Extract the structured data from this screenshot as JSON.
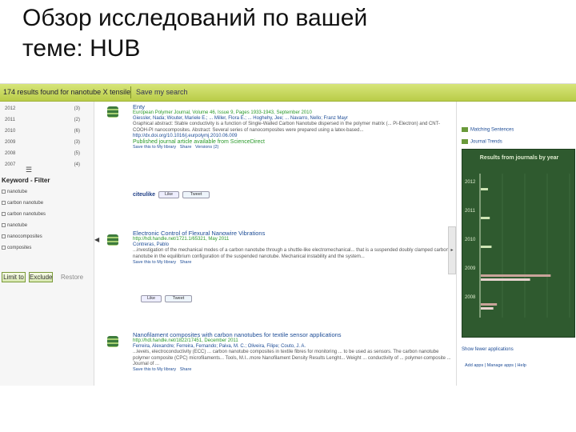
{
  "slide": {
    "title_line1": "Обзор исследований по вашей",
    "title_line2": "теме: HUB"
  },
  "topbar": {
    "query": "174 results found for nanotube X tensile",
    "save_link": "Save my search"
  },
  "filters": {
    "years": [
      {
        "year": "2012",
        "count": "(3)"
      },
      {
        "year": "2011",
        "count": "(2)"
      },
      {
        "year": "2010",
        "count": "(6)"
      },
      {
        "year": "2009",
        "count": "(3)"
      },
      {
        "year": "2008",
        "count": "(5)"
      },
      {
        "year": "2007",
        "count": "(4)"
      }
    ],
    "keyword_title": "Keyword - Filter",
    "keywords": [
      "nanotube",
      "carbon nanotube",
      "carbon nanotubes",
      "nanotube",
      "nanocomposites",
      "composites"
    ],
    "filter_button": "Limit to",
    "exclude_button": "Exclude",
    "restore_label": "Restore"
  },
  "results": [
    {
      "title": "Enty",
      "source": "European Polymer Journal, Volume 46, Issue 9, Pages 1933-1943, September 2010",
      "authors": "Giessler, Nada; Wouter, Mariele E.; ... Miller, Flora E.; ... Hoghehy, Jee; ... Navarro, Nello; Franz Mayr",
      "snippet": "Graphical abstract: Stable conductivity is a function of Single-Walled Carbon Nanotube dispersed in the polymer matrix (... Pi-Electron) and CNT-COOH-PI nanocomposites. Abstract: Several series of nanocomposites were prepared using a latex-based...",
      "doi": "http://dx.doi.org/10.1016/j.eurpolymj.2010.06.009",
      "published": "Published journal article available from ScienceDirect",
      "links": [
        "Save this to My library",
        "Share",
        "Versions (2)"
      ],
      "citeulike": "citeulike",
      "like": "Like",
      "tweet": "Tweet"
    },
    {
      "title": "Electronic Control of Flexural Nanowire Vibrations",
      "source": "http://hdl.handle.net/1721.1/65321, May 2011",
      "authors": "Contreras, Pablo",
      "snippet": "...investigation of the mechanical modes of a carbon nanotube through a shuttle-like electromechanical... that is a suspended doubly clamped carbon nanotube in the equilibrium configuration of the suspended nanotube. Mechanical instability and the system...",
      "links": [
        "Save this to My library",
        "Share"
      ],
      "like": "Like",
      "tweet": "Tweet"
    },
    {
      "title": "Nanofilament composites with carbon nanotubes for textile sensor applications",
      "source": "http://hdl.handle.net/1822/17451, December 2011",
      "authors": "Ferreira, Alexandre; Ferreira, Fernando; Paiva, M. C.; Oliveira, Filipe; Couto, J. A.",
      "snippet": "...levels, electroconductivity (ECC) ... carbon nanotube composites in textile fibres for monitoring ... to be used as sensors. The carbon nanotube polymer composite (CPC) microfilaments... Tools, M.I...more Nanofilament Density Results Lenght... Weight ... conductivity of ... polymer-composite ... Journal of ...",
      "links": [
        "Save this to My library",
        "Share"
      ]
    }
  ],
  "sidebar": {
    "matching_sentences": "Matching Sentences",
    "journal_trends": "Journal Trends",
    "panel_title": "Results from journals by year",
    "show_fewer": "Show fewer applications",
    "footer_links": "Add apps | Manage apps | Help"
  },
  "chart_data": {
    "type": "bar",
    "orientation": "horizontal",
    "title": "Results from journals by year",
    "categories": [
      "2012",
      "2011",
      "2010",
      "2009",
      "2008"
    ],
    "series": [
      {
        "values": [
          8,
          10,
          12,
          78,
          18
        ]
      },
      {
        "values": [
          0,
          0,
          0,
          55,
          14
        ]
      }
    ]
  },
  "colors": {
    "topbar": "#c6d85a",
    "panel_bg": "#2f5a2f",
    "bar_main": "#c9a39a",
    "bar_alt": "#e8d3cf",
    "bar_small": "#cfe5b5",
    "link_blue": "#1d4c96",
    "source_green": "#2b9a2b"
  }
}
